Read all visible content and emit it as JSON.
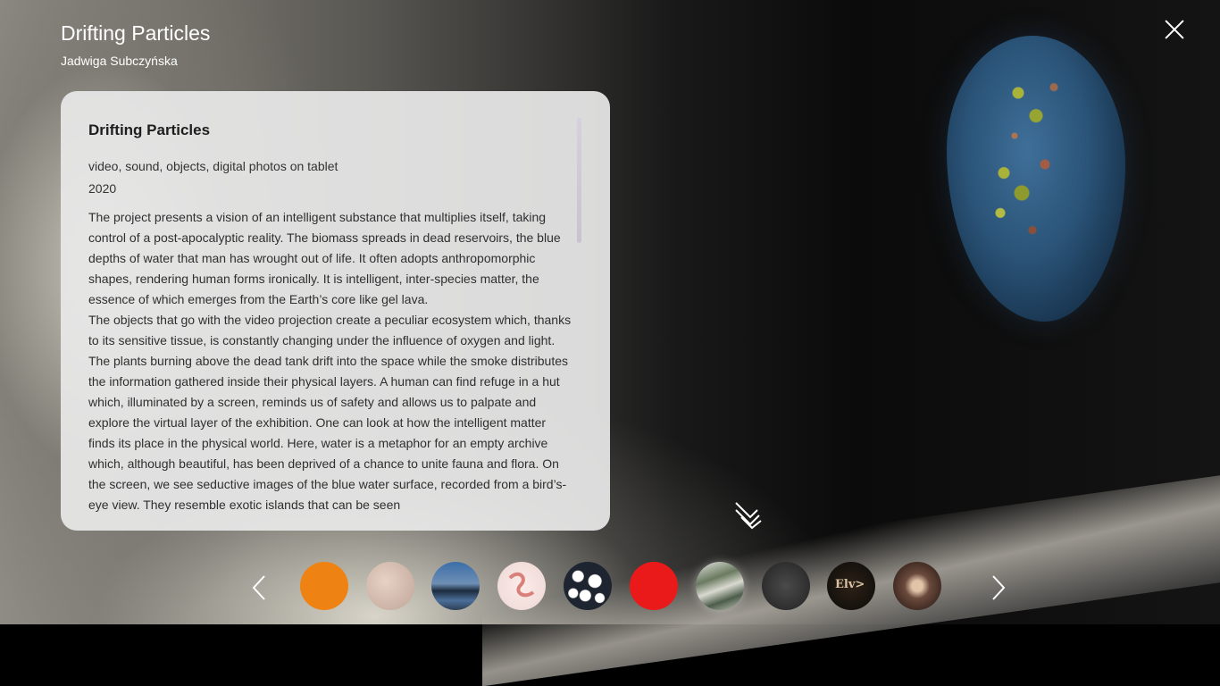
{
  "header": {
    "title": "Drifting Particles",
    "artist": "Jadwiga Subczyńska"
  },
  "panel": {
    "heading": "Drifting Particles",
    "medium": "video, sound, objects, digital photos on tablet",
    "year": "2020",
    "description_p1": "The project presents a vision of an intelligent substance that multiplies itself, taking control of a post-apocalyptic reality. The biomass spreads in dead reservoirs, the blue depths of water that man has wrought out of life. It often adopts anthropomorphic shapes, rendering human forms ironically. It is intelligent, inter-species matter, the essence of which emerges from the Earth’s core like gel lava.",
    "description_p2": "The objects that go with the video projection create a peculiar ecosystem which, thanks to its sensitive tissue, is constantly changing under the influence of oxygen and light. The plants burning above the dead tank drift into the space while the smoke distributes the information gathered inside their physical layers. A human can find refuge in a hut which, illuminated by a screen, reminds us of safety and allows us to palpate and explore the virtual layer of the exhibition. One can look at how the intelligent matter finds its place in the physical world. Here, water is a metaphor for an empty archive which, although beautiful, has been deprived of a chance to unite fauna and flora. On the screen, we see seductive images of the blue water surface, recorded from a bird’s-eye view. They resemble exotic islands that can be seen"
  },
  "thumbnails": [
    {
      "name": "thumb-orange",
      "color": "#ee8314"
    },
    {
      "name": "thumb-skin-texture"
    },
    {
      "name": "thumb-sky-landscape"
    },
    {
      "name": "thumb-coil-pattern"
    },
    {
      "name": "thumb-coral-pattern"
    },
    {
      "name": "thumb-red",
      "color": "#ea1a1a"
    },
    {
      "name": "thumb-water-surface",
      "selected": true
    },
    {
      "name": "thumb-gray-objects"
    },
    {
      "name": "thumb-elv-logo",
      "text": "Elv>"
    },
    {
      "name": "thumb-flower"
    }
  ],
  "icons": {
    "close": "close-icon",
    "prev": "chevron-left-icon",
    "next": "chevron-right-icon",
    "scroll_hint": "double-chevron-icon"
  }
}
